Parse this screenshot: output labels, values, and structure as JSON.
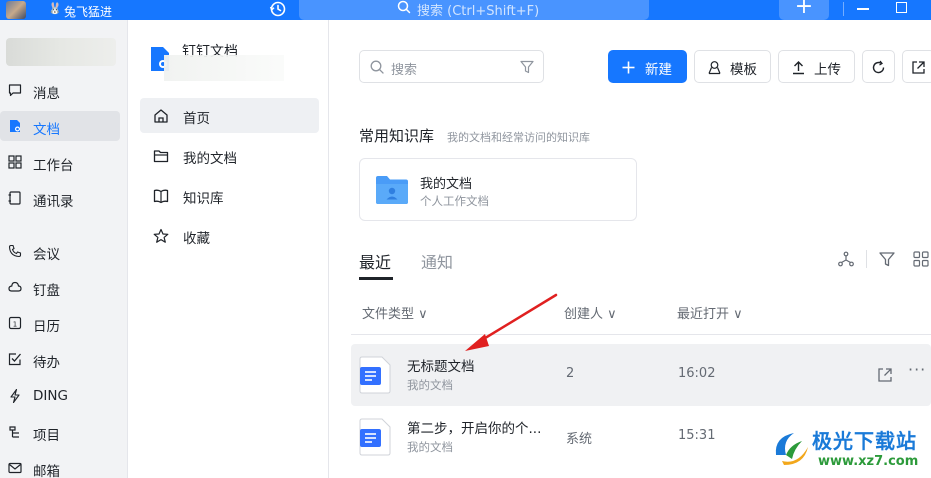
{
  "topbar": {
    "user_name": "兔飞猛进",
    "search_placeholder": "搜索 (Ctrl+Shift+F)",
    "plus_label": "+"
  },
  "leftnav": {
    "items": [
      {
        "label": "消息",
        "icon": "message-icon"
      },
      {
        "label": "文档",
        "icon": "document-icon",
        "active": true
      },
      {
        "label": "工作台",
        "icon": "grid-icon"
      },
      {
        "label": "通讯录",
        "icon": "contacts-icon"
      },
      {
        "label": "会议",
        "icon": "phone-icon"
      },
      {
        "label": "钉盘",
        "icon": "cloud-icon"
      },
      {
        "label": "日历",
        "icon": "calendar-icon"
      },
      {
        "label": "待办",
        "icon": "todo-icon"
      },
      {
        "label": "DING",
        "icon": "lightning-icon"
      },
      {
        "label": "项目",
        "icon": "project-icon"
      },
      {
        "label": "邮箱",
        "icon": "mail-icon"
      }
    ]
  },
  "docsidebar": {
    "app_title": "钉钉文档",
    "items": [
      {
        "label": "首页",
        "icon": "home-icon",
        "active": true
      },
      {
        "label": "我的文档",
        "icon": "folder-icon"
      },
      {
        "label": "知识库",
        "icon": "book-icon"
      },
      {
        "label": "收藏",
        "icon": "star-icon"
      }
    ]
  },
  "main": {
    "search_placeholder": "搜索",
    "buttons": {
      "new": "新建",
      "template": "模板",
      "upload": "上传"
    },
    "kb_section": {
      "title": "常用知识库",
      "subtitle": "我的文档和经常访问的知识库",
      "card": {
        "name": "我的文档",
        "desc": "个人工作文档"
      }
    },
    "tabs": {
      "recent": "最近",
      "notice": "通知"
    },
    "columns": {
      "type": "文件类型",
      "creator": "创建人",
      "opened": "最近打开"
    },
    "rows": [
      {
        "name": "无标题文档",
        "location": "我的文档",
        "creator": "2",
        "time": "16:02"
      },
      {
        "name": "第二步，开启你的个...",
        "location": "我的文档",
        "creator": "系统",
        "time": "15:31"
      }
    ],
    "more_label": "···"
  },
  "watermark": {
    "title": "极光下载站",
    "url": "www.xz7.com"
  },
  "colors": {
    "accent": "#1677ff",
    "annotation_arrow": "#e02020"
  }
}
